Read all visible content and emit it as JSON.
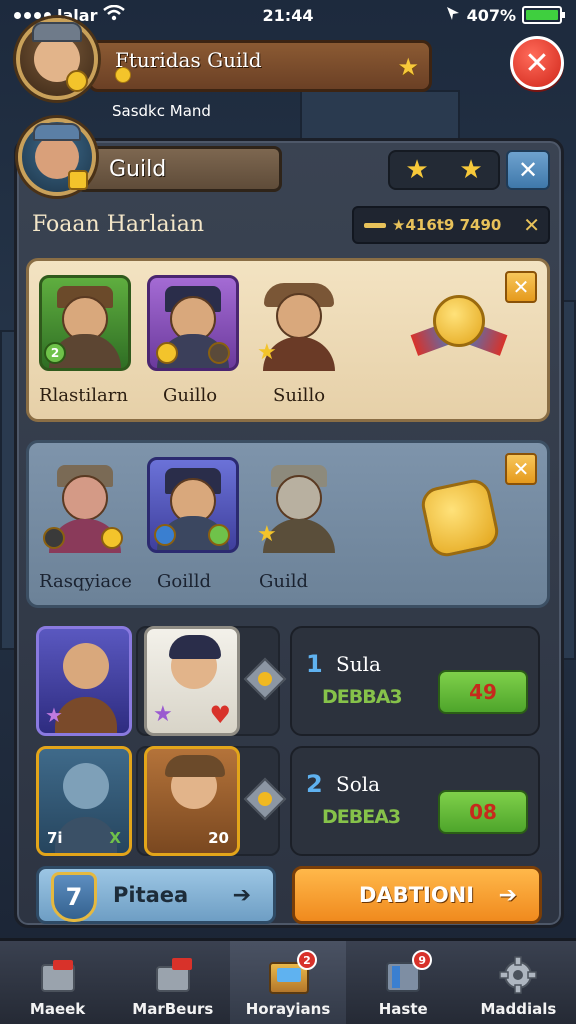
{
  "status_bar": {
    "carrier": "lalar",
    "time": "21:44",
    "battery": "407%"
  },
  "header": {
    "title": "Fturidas Guild",
    "subtitle": "Sasdkc Mand"
  },
  "guild": {
    "label": "Guild",
    "member_name": "Foaan Harlaian",
    "code": "★416t9 7490"
  },
  "card1": {
    "heroes": [
      {
        "label": "Rlastilarn",
        "badge": "2"
      },
      {
        "label": "Guillo",
        "badge": ""
      },
      {
        "label": "Suillo",
        "badge": ""
      }
    ]
  },
  "card2": {
    "heroes": [
      {
        "label": "Rasqyiace",
        "badge": ""
      },
      {
        "label": "Goilld",
        "badge": ""
      },
      {
        "label": "Guild",
        "badge": ""
      }
    ]
  },
  "lower": {
    "row2_left": "7i",
    "row2_badge": "X",
    "row2_count": "20"
  },
  "quests": [
    {
      "num": "1",
      "title": "Sula",
      "sub": "DEBBA3",
      "button": "49"
    },
    {
      "num": "2",
      "title": "Sola",
      "sub": "DEBEA3",
      "button": "08"
    }
  ],
  "buttons": {
    "left": "Pitaea",
    "left_badge": "7",
    "right": "DABTIONI"
  },
  "nav": [
    {
      "label": "Maeek",
      "icon": "chest-icon",
      "badge": ""
    },
    {
      "label": "MarBeurs",
      "icon": "cart-icon",
      "badge": ""
    },
    {
      "label": "Horayians",
      "icon": "treasure-icon",
      "badge": "2"
    },
    {
      "label": "Haste",
      "icon": "book-icon",
      "badge": "9"
    },
    {
      "label": "Maddials",
      "icon": "gear-icon",
      "badge": ""
    }
  ]
}
